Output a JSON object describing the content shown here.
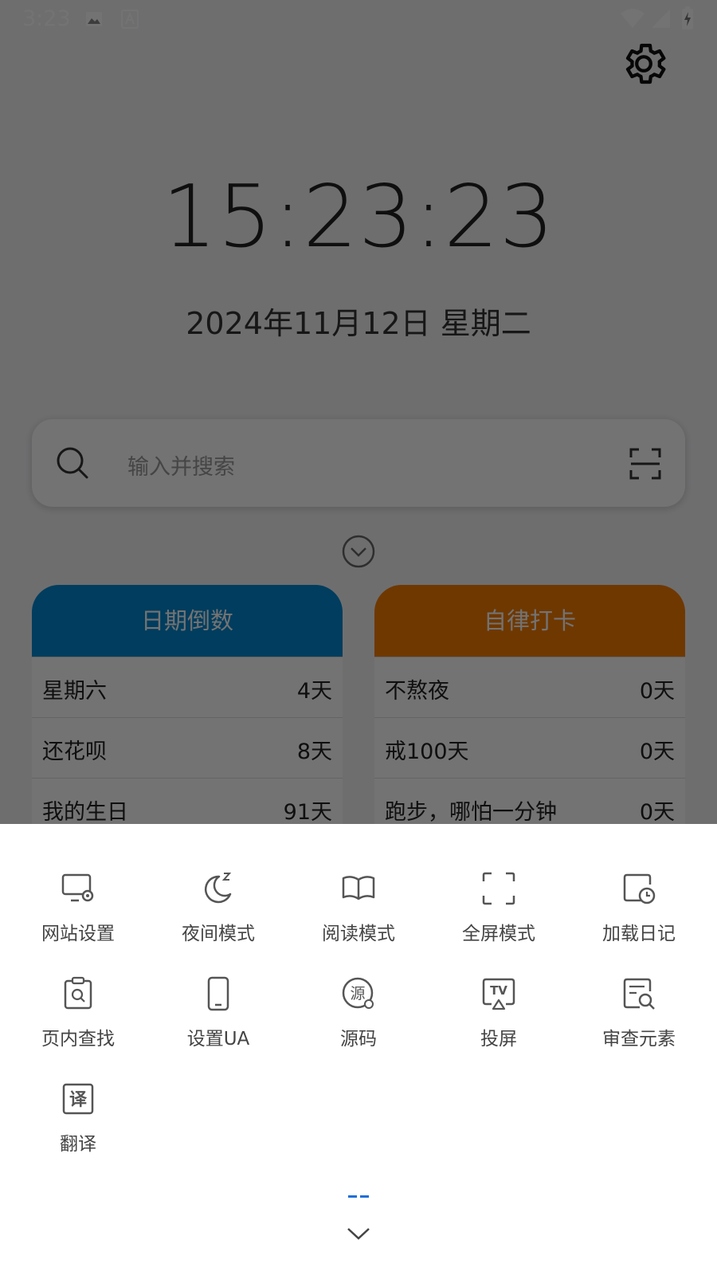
{
  "status_bar": {
    "time": "3:23"
  },
  "clock": {
    "time": "15:23:23",
    "date": "2024年11月12日 星期二"
  },
  "search": {
    "placeholder": "输入并搜索"
  },
  "cards": {
    "countdown": {
      "title": "日期倒数",
      "color": "#0288D1",
      "items": [
        {
          "name": "星期六",
          "value": "4天"
        },
        {
          "name": "还花呗",
          "value": "8天"
        },
        {
          "name": "我的生日",
          "value": "91天"
        }
      ]
    },
    "checkin": {
      "title": "自律打卡",
      "color": "#F57C00",
      "items": [
        {
          "name": "不熬夜",
          "value": "0天"
        },
        {
          "name": "戒100天",
          "value": "0天"
        },
        {
          "name": "跑步，哪怕一分钟",
          "value": "0天"
        }
      ]
    }
  },
  "menu": [
    {
      "label": "网站设置",
      "icon": "monitor-gear-icon"
    },
    {
      "label": "夜间模式",
      "icon": "moon-icon"
    },
    {
      "label": "阅读模式",
      "icon": "book-icon"
    },
    {
      "label": "全屏模式",
      "icon": "fullscreen-icon"
    },
    {
      "label": "加载日记",
      "icon": "log-clock-icon"
    },
    {
      "label": "页内查找",
      "icon": "clipboard-search-icon"
    },
    {
      "label": "设置UA",
      "icon": "phone-icon"
    },
    {
      "label": "源码",
      "icon": "source-icon",
      "glyph": "源"
    },
    {
      "label": "投屏",
      "icon": "cast-tv-icon",
      "glyph": "TV"
    },
    {
      "label": "审查元素",
      "icon": "inspect-icon"
    },
    {
      "label": "翻译",
      "icon": "translate-icon",
      "glyph": "译"
    }
  ]
}
